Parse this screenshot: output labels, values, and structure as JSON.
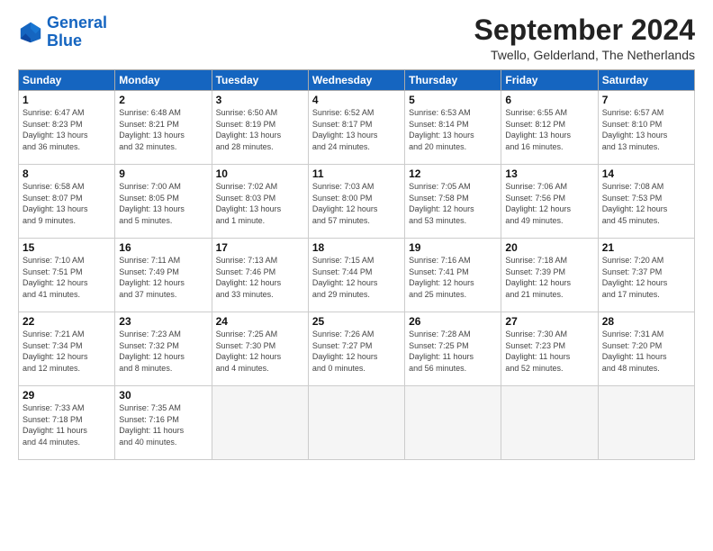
{
  "header": {
    "logo_line1": "General",
    "logo_line2": "Blue",
    "month_title": "September 2024",
    "subtitle": "Twello, Gelderland, The Netherlands"
  },
  "weekdays": [
    "Sunday",
    "Monday",
    "Tuesday",
    "Wednesday",
    "Thursday",
    "Friday",
    "Saturday"
  ],
  "weeks": [
    [
      {
        "day": "1",
        "info": "Sunrise: 6:47 AM\nSunset: 8:23 PM\nDaylight: 13 hours\nand 36 minutes."
      },
      {
        "day": "2",
        "info": "Sunrise: 6:48 AM\nSunset: 8:21 PM\nDaylight: 13 hours\nand 32 minutes."
      },
      {
        "day": "3",
        "info": "Sunrise: 6:50 AM\nSunset: 8:19 PM\nDaylight: 13 hours\nand 28 minutes."
      },
      {
        "day": "4",
        "info": "Sunrise: 6:52 AM\nSunset: 8:17 PM\nDaylight: 13 hours\nand 24 minutes."
      },
      {
        "day": "5",
        "info": "Sunrise: 6:53 AM\nSunset: 8:14 PM\nDaylight: 13 hours\nand 20 minutes."
      },
      {
        "day": "6",
        "info": "Sunrise: 6:55 AM\nSunset: 8:12 PM\nDaylight: 13 hours\nand 16 minutes."
      },
      {
        "day": "7",
        "info": "Sunrise: 6:57 AM\nSunset: 8:10 PM\nDaylight: 13 hours\nand 13 minutes."
      }
    ],
    [
      {
        "day": "8",
        "info": "Sunrise: 6:58 AM\nSunset: 8:07 PM\nDaylight: 13 hours\nand 9 minutes."
      },
      {
        "day": "9",
        "info": "Sunrise: 7:00 AM\nSunset: 8:05 PM\nDaylight: 13 hours\nand 5 minutes."
      },
      {
        "day": "10",
        "info": "Sunrise: 7:02 AM\nSunset: 8:03 PM\nDaylight: 13 hours\nand 1 minute."
      },
      {
        "day": "11",
        "info": "Sunrise: 7:03 AM\nSunset: 8:00 PM\nDaylight: 12 hours\nand 57 minutes."
      },
      {
        "day": "12",
        "info": "Sunrise: 7:05 AM\nSunset: 7:58 PM\nDaylight: 12 hours\nand 53 minutes."
      },
      {
        "day": "13",
        "info": "Sunrise: 7:06 AM\nSunset: 7:56 PM\nDaylight: 12 hours\nand 49 minutes."
      },
      {
        "day": "14",
        "info": "Sunrise: 7:08 AM\nSunset: 7:53 PM\nDaylight: 12 hours\nand 45 minutes."
      }
    ],
    [
      {
        "day": "15",
        "info": "Sunrise: 7:10 AM\nSunset: 7:51 PM\nDaylight: 12 hours\nand 41 minutes."
      },
      {
        "day": "16",
        "info": "Sunrise: 7:11 AM\nSunset: 7:49 PM\nDaylight: 12 hours\nand 37 minutes."
      },
      {
        "day": "17",
        "info": "Sunrise: 7:13 AM\nSunset: 7:46 PM\nDaylight: 12 hours\nand 33 minutes."
      },
      {
        "day": "18",
        "info": "Sunrise: 7:15 AM\nSunset: 7:44 PM\nDaylight: 12 hours\nand 29 minutes."
      },
      {
        "day": "19",
        "info": "Sunrise: 7:16 AM\nSunset: 7:41 PM\nDaylight: 12 hours\nand 25 minutes."
      },
      {
        "day": "20",
        "info": "Sunrise: 7:18 AM\nSunset: 7:39 PM\nDaylight: 12 hours\nand 21 minutes."
      },
      {
        "day": "21",
        "info": "Sunrise: 7:20 AM\nSunset: 7:37 PM\nDaylight: 12 hours\nand 17 minutes."
      }
    ],
    [
      {
        "day": "22",
        "info": "Sunrise: 7:21 AM\nSunset: 7:34 PM\nDaylight: 12 hours\nand 12 minutes."
      },
      {
        "day": "23",
        "info": "Sunrise: 7:23 AM\nSunset: 7:32 PM\nDaylight: 12 hours\nand 8 minutes."
      },
      {
        "day": "24",
        "info": "Sunrise: 7:25 AM\nSunset: 7:30 PM\nDaylight: 12 hours\nand 4 minutes."
      },
      {
        "day": "25",
        "info": "Sunrise: 7:26 AM\nSunset: 7:27 PM\nDaylight: 12 hours\nand 0 minutes."
      },
      {
        "day": "26",
        "info": "Sunrise: 7:28 AM\nSunset: 7:25 PM\nDaylight: 11 hours\nand 56 minutes."
      },
      {
        "day": "27",
        "info": "Sunrise: 7:30 AM\nSunset: 7:23 PM\nDaylight: 11 hours\nand 52 minutes."
      },
      {
        "day": "28",
        "info": "Sunrise: 7:31 AM\nSunset: 7:20 PM\nDaylight: 11 hours\nand 48 minutes."
      }
    ],
    [
      {
        "day": "29",
        "info": "Sunrise: 7:33 AM\nSunset: 7:18 PM\nDaylight: 11 hours\nand 44 minutes."
      },
      {
        "day": "30",
        "info": "Sunrise: 7:35 AM\nSunset: 7:16 PM\nDaylight: 11 hours\nand 40 minutes."
      },
      {
        "day": "",
        "info": ""
      },
      {
        "day": "",
        "info": ""
      },
      {
        "day": "",
        "info": ""
      },
      {
        "day": "",
        "info": ""
      },
      {
        "day": "",
        "info": ""
      }
    ]
  ]
}
